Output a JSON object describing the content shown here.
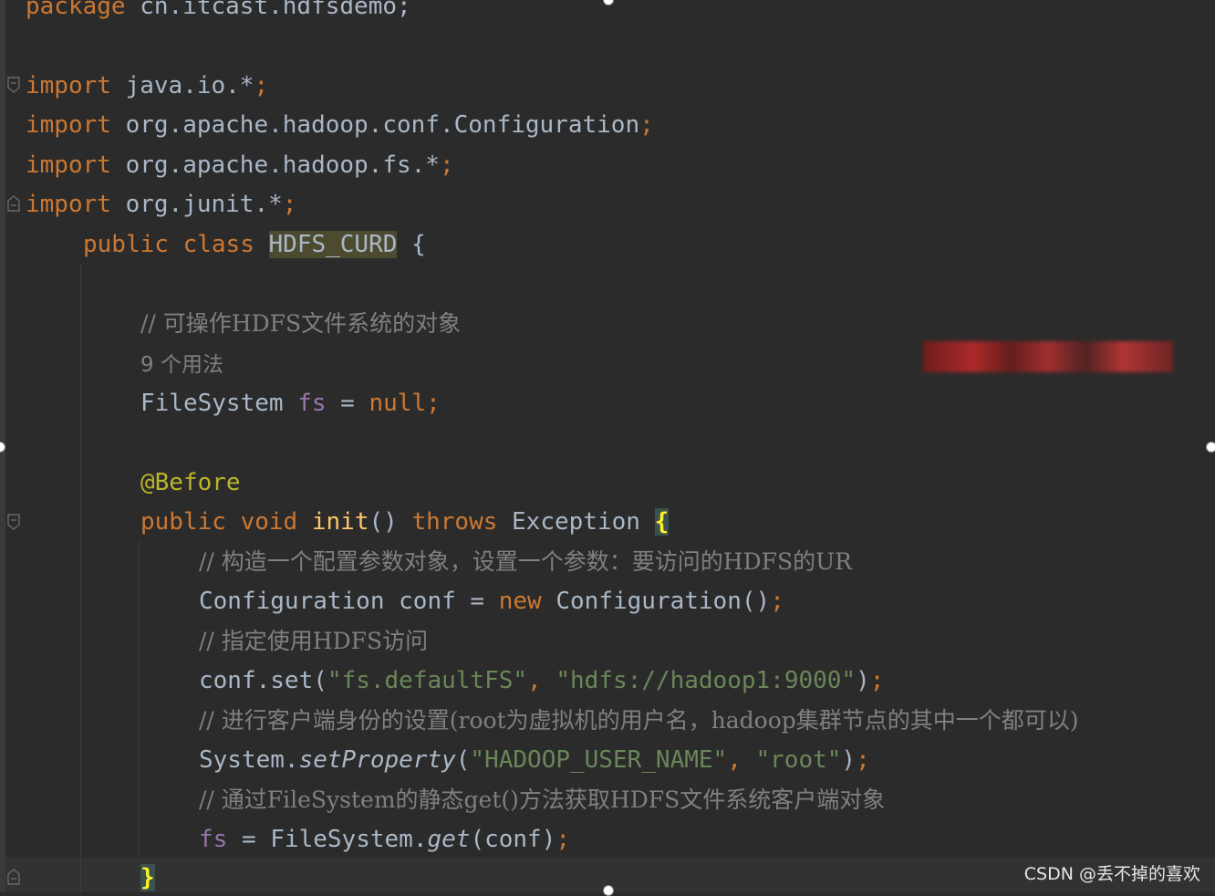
{
  "code": {
    "package_kw": "package",
    "package_name": "cn.itcast.hdfsdemo;",
    "imports": [
      {
        "kw": "import",
        "path": "java.io.*",
        "semi": ";"
      },
      {
        "kw": "import",
        "path": "org.apache.hadoop.conf.Configuration",
        "semi": ";"
      },
      {
        "kw": "import",
        "path": "org.apache.hadoop.fs.*",
        "semi": ";"
      },
      {
        "kw": "import",
        "path": "org.junit.*",
        "semi": ";"
      }
    ],
    "class_decl": {
      "public": "public",
      "class": "class",
      "name": "HDFS_CURD",
      "brace": "{"
    },
    "comment1": "// 可操作HDFS文件系统的对象",
    "usage_hint": "9 个用法",
    "field_line": {
      "type": "FileSystem",
      "name": "fs",
      "eq": " = ",
      "value": "null",
      "semi": ";"
    },
    "annotation": "@Before",
    "method_decl": {
      "public": "public",
      "void": "void",
      "name": "init",
      "parens": "()",
      "throws": "throws",
      "exc": "Exception",
      "brace": "{"
    },
    "comment2": "// 构造一个配置参数对象，设置一个参数：要访问的HDFS的UR",
    "conf_line": {
      "type": "Configuration",
      "var": "conf",
      "eq": " = ",
      "new": "new",
      "ctor": "Configuration()",
      "semi": ";"
    },
    "comment3": "// 指定使用HDFS访问",
    "set_line": {
      "call": "conf.set(",
      "arg1": "\"fs.defaultFS\"",
      "comma": ", ",
      "arg2": "\"hdfs://hadoop1:9000\"",
      "close": ")",
      "semi": ";"
    },
    "comment4": "// 进行客户端身份的设置(root为虚拟机的用户名，hadoop集群节点的其中一个都可以)",
    "prop_line": {
      "obj": "System.",
      "method": "setProperty",
      "open": "(",
      "arg1": "\"HADOOP_USER_NAME\"",
      "comma": ", ",
      "arg2": "\"root\"",
      "close": ")",
      "semi": ";"
    },
    "comment5": "// 通过FileSystem的静态get()方法获取HDFS文件系统客户端对象",
    "get_line": {
      "field": "fs",
      "eq": " = ",
      "obj": "FileSystem.",
      "method": "get",
      "args": "(conf)",
      "semi": ";"
    },
    "close_brace": "}"
  },
  "watermark": "CSDN @丢不掉的喜欢",
  "icons": [
    "fold-icon"
  ]
}
